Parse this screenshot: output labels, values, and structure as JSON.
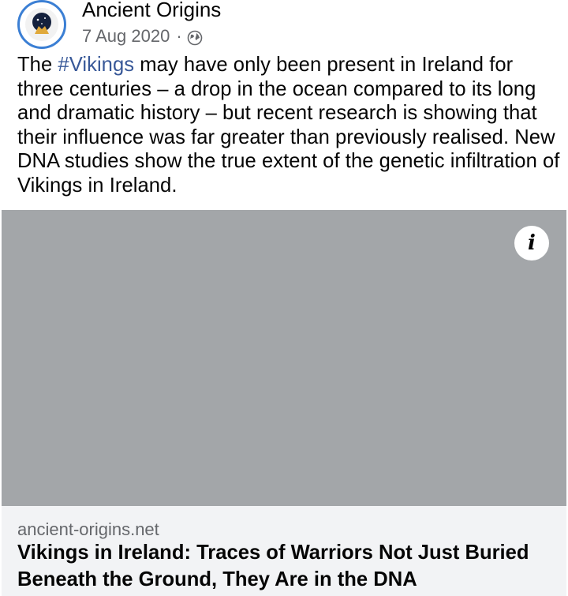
{
  "post": {
    "page_name": "Ancient Origins",
    "date": "7 Aug 2020",
    "separator": "·",
    "privacy_icon": "globe-icon",
    "text_before_hashtag": "The ",
    "hashtag": "#Vikings",
    "text_after_hashtag": " may have only been present in Ireland for three centuries – a drop in the ocean compared to its long and dramatic history – but recent research is showing that their influence was far greater than previously realised. New DNA studies show the true extent of the genetic infiltration of Vikings in Ireland."
  },
  "media": {
    "info_label": "i",
    "placeholder_color": "#a3a6a9"
  },
  "link": {
    "domain": "ancient-origins.net",
    "title": "Vikings in Ireland: Traces of Warriors Not Just Buried Beneath the Ground, They Are in the DNA"
  },
  "colors": {
    "hashtag": "#385898",
    "avatar_ring": "#3b7fd4",
    "secondary_text": "#65676b",
    "link_bg": "#f2f3f5"
  }
}
